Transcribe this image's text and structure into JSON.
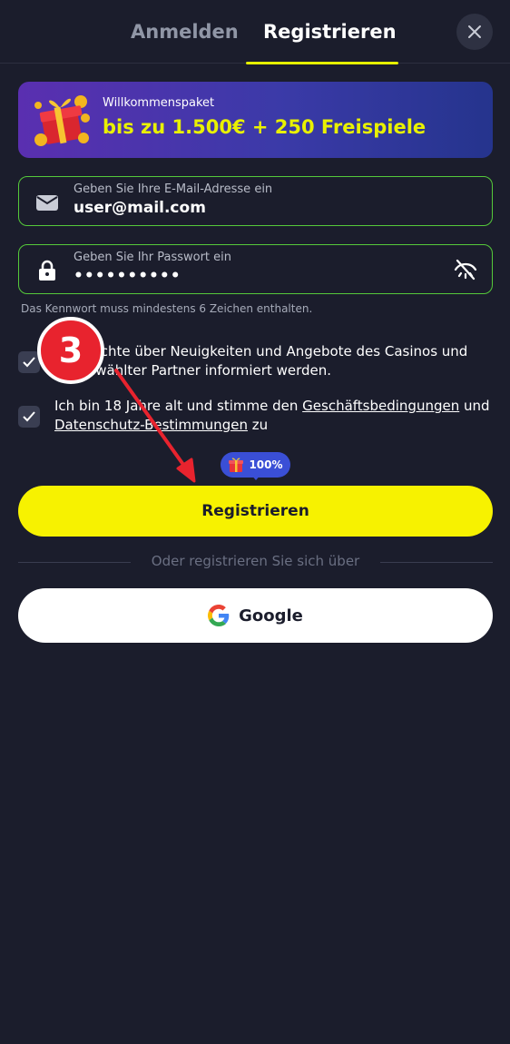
{
  "tabs": {
    "login": "Anmelden",
    "register": "Registrieren",
    "close_icon": "close-icon"
  },
  "banner": {
    "label": "Willkommenspaket",
    "value": "bis zu 1.500€ + 250 Freispiele",
    "icon": "gift-coins-icon"
  },
  "email": {
    "label": "Geben Sie Ihre E-Mail-Adresse ein",
    "value": "user@mail.com",
    "icon": "envelope-icon"
  },
  "password": {
    "label": "Geben Sie Ihr Passwort ein",
    "value": "••••••••••",
    "icon": "lock-icon",
    "toggle_icon": "eye-off-icon"
  },
  "password_hint": "Das Kennwort muss mindestens 6 Zeichen enthalten.",
  "checkboxes": [
    {
      "text": "Ich möchte über Neuigkeiten und Angebote des Casinos und ausgewählter Partner informiert werden.",
      "checked": true
    },
    {
      "prefix": "Ich bin 18 Jahre alt und stimme den ",
      "link1": "Geschäftsbedingungen",
      "middle": " und ",
      "link2": "Datenschutz-Bestimmungen",
      "suffix": " zu",
      "checked": true
    }
  ],
  "annotation": {
    "step": "3"
  },
  "bonus_pill": {
    "text": "100%",
    "icon": "gift-icon"
  },
  "submit_label": "Registrieren",
  "divider_text": "Oder registrieren Sie sich über",
  "google_label": "Google",
  "colors": {
    "accent_yellow": "#f7f200",
    "field_border": "#55c93a",
    "background": "#1b1d2c",
    "step_red": "#e8232e",
    "pill_blue": "#3a4fd6"
  }
}
